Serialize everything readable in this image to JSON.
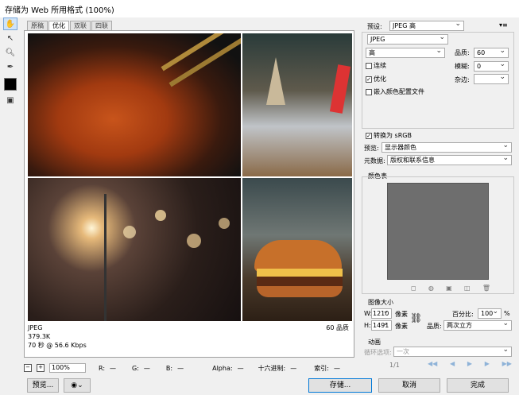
{
  "window": {
    "title": "存储为 Web 所用格式 (100%)"
  },
  "tools": [
    "hand-tool",
    "slice-select-tool",
    "zoom-tool",
    "eyedropper-tool",
    "eyedropper-color",
    "toggle-slices"
  ],
  "tabs": [
    {
      "label": "原稿"
    },
    {
      "label": "优化",
      "active": true
    },
    {
      "label": "双联"
    },
    {
      "label": "四联"
    }
  ],
  "status": {
    "format": "JPEG",
    "size": "379.3K",
    "speed": "70 秒 @ 56.6 Kbps",
    "quality": "60 品质"
  },
  "bottombar": {
    "zoom": "100%",
    "r_label": "R:",
    "r_val": "—",
    "g_label": "G:",
    "g_val": "—",
    "b_label": "B:",
    "b_val": "—",
    "alpha_label": "Alpha:",
    "alpha_val": "—",
    "hex_label": "十六进制:",
    "hex_val": "—",
    "index_label": "索引:",
    "index_val": "—"
  },
  "buttons": {
    "preview": "预览...",
    "save": "存储...",
    "cancel": "取消",
    "done": "完成"
  },
  "settings": {
    "preset_label": "预设:",
    "preset_value": "JPEG 高",
    "format_value": "JPEG",
    "quality_level": "高",
    "quality_label": "品质:",
    "quality_value": "60",
    "progressive_label": "连续",
    "blur_label": "模糊:",
    "blur_value": "0",
    "optimized_label": "优化",
    "matte_label": "杂边:",
    "icc_label": "嵌入颜色配置文件",
    "srgb_label": "转换为 sRGB",
    "preview_label": "预览:",
    "preview_value": "显示器颜色",
    "metadata_label": "元数据:",
    "metadata_value": "版权和联系信息",
    "color_table_label": "颜色表"
  },
  "image_size": {
    "title": "图像大小",
    "w_label": "W:",
    "w_value": "1210",
    "h_label": "H:",
    "h_value": "1491",
    "unit": "像素",
    "percent_label": "百分比:",
    "percent_value": "100",
    "percent_unit": "%",
    "quality_label": "品质:",
    "quality_value": "两次立方"
  },
  "animation": {
    "title": "动画",
    "loop_label": "循环选项:",
    "loop_value": "一次",
    "frame": "1/1"
  }
}
